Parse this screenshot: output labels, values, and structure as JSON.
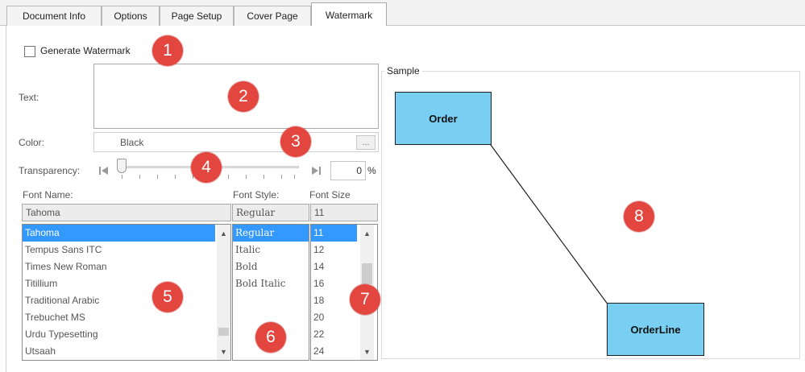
{
  "tabs": [
    {
      "label": "Document Info"
    },
    {
      "label": "Options"
    },
    {
      "label": "Page Setup"
    },
    {
      "label": "Cover Page"
    },
    {
      "label": "Watermark",
      "active": true
    }
  ],
  "watermark": {
    "generate_label": "Generate Watermark",
    "generate_checked": false,
    "text_label": "Text:",
    "text_value": "",
    "color_label": "Color:",
    "color_value": "Black",
    "color_browse_label": "...",
    "transparency_label": "Transparency:",
    "transparency_value": "0",
    "transparency_unit": "%",
    "font_name_label": "Font Name:",
    "font_style_label": "Font Style:",
    "font_size_label": "Font Size",
    "font_name_value": "Tahoma",
    "font_style_value": "Regular",
    "font_size_value": "11",
    "font_names": [
      "Tahoma",
      "Tempus Sans ITC",
      "Times New Roman",
      "Titillium",
      "Traditional Arabic",
      "Trebuchet MS",
      "Urdu Typesetting",
      "Utsaah"
    ],
    "font_styles": [
      "Regular",
      "Italic",
      "Bold",
      "Bold Italic"
    ],
    "font_sizes": [
      "11",
      "12",
      "14",
      "16",
      "18",
      "20",
      "22",
      "24"
    ]
  },
  "sample": {
    "legend": "Sample",
    "entity_order": "Order",
    "entity_orderline": "OrderLine"
  },
  "badges": [
    "1",
    "2",
    "3",
    "4",
    "5",
    "6",
    "7",
    "8"
  ],
  "colors": {
    "entity_fill": "#79cff2",
    "selection": "#3399ff",
    "badge": "#e2463f"
  },
  "icons": {
    "slider_min": "skip-back-icon",
    "slider_max": "skip-forward-icon",
    "scroll_up": "chevron-up-icon",
    "scroll_down": "chevron-down-icon"
  }
}
